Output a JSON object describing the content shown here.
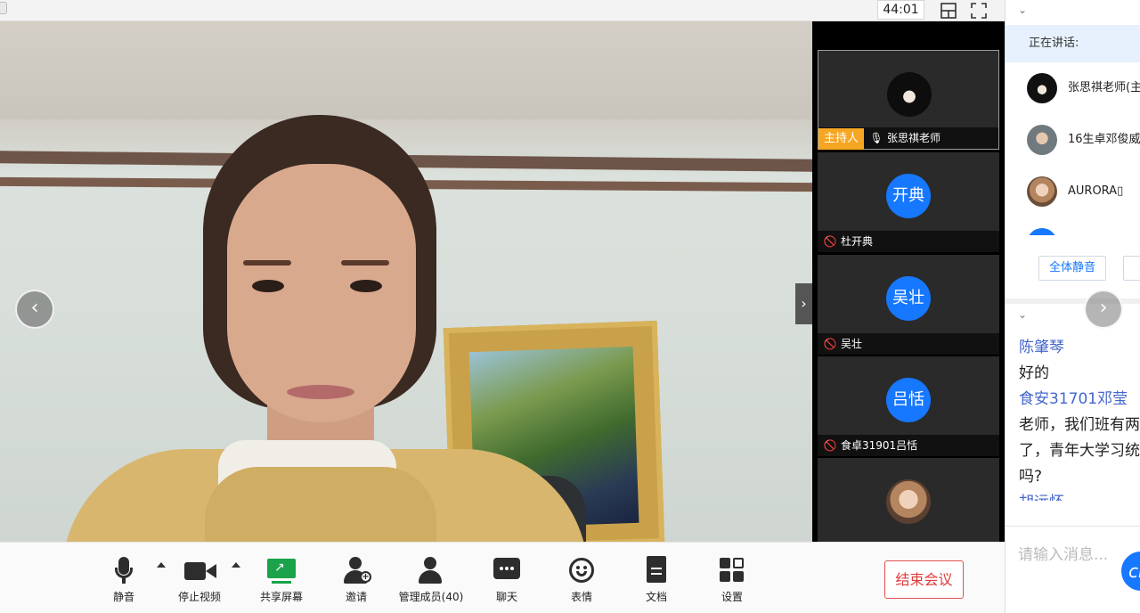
{
  "topbar": {
    "timer": "44:01"
  },
  "strip": {
    "host_label": "主持人",
    "tiles": [
      {
        "name": "张思祺老师",
        "avatar_text": ""
      },
      {
        "name": "杜开典",
        "avatar_text": "开典"
      },
      {
        "name": "吴壮",
        "avatar_text": "吴壮"
      },
      {
        "name": "食卓31901吕恬",
        "avatar_text": "吕恬"
      }
    ]
  },
  "panel": {
    "speaking_label": "正在讲话:",
    "members": [
      {
        "name": "张思祺老师(主"
      },
      {
        "name": "16生卓邓俊威"
      },
      {
        "name": "AURORA▯"
      }
    ],
    "mute_all_label": "全体静音",
    "chat": [
      {
        "sender": "陈肇琴",
        "text": "好的"
      },
      {
        "sender": "食安31701邓莹",
        "text_lines": [
          "老师，我们班有两",
          "了，青年大学习统",
          "吗?"
        ]
      },
      {
        "sender": "胡远怀"
      }
    ],
    "chat_placeholder": "请输入消息...",
    "send_label": "cl"
  },
  "toolbar": {
    "mute": "静音",
    "stop_video": "停止视频",
    "share_screen": "共享屏幕",
    "invite": "邀请",
    "manage_members": "管理成员(40)",
    "chat": "聊天",
    "emoji": "表情",
    "docs": "文档",
    "settings": "设置",
    "end_meeting": "结束会议"
  },
  "colors": {
    "accent": "#1677ff",
    "host_tag": "#f5a623",
    "end": "#e03a3a",
    "share": "#1aa34a"
  }
}
